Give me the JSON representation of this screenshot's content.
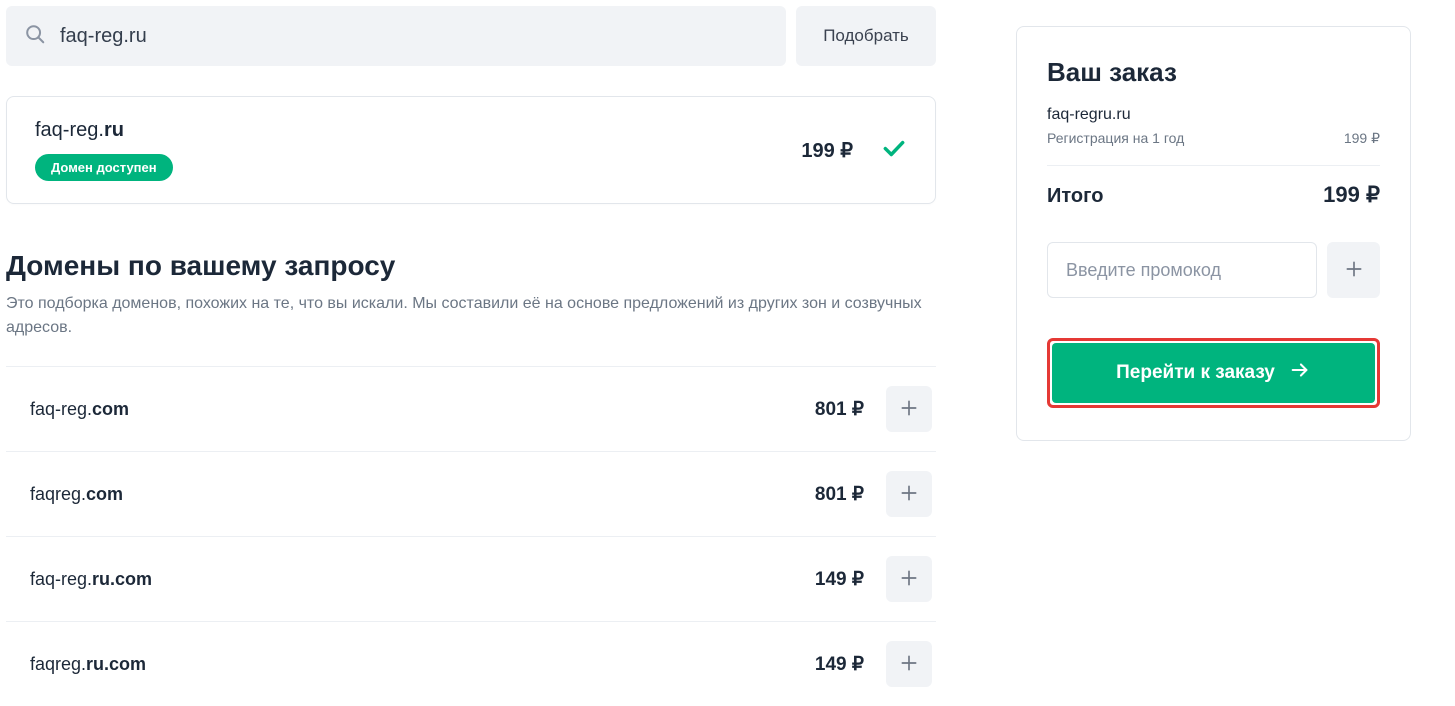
{
  "search": {
    "value": "faq-reg.ru",
    "button_label": "Подобрать"
  },
  "selected": {
    "name": "faq-reg.",
    "tld": "ru",
    "price": "199 ₽",
    "badge": "Домен доступен"
  },
  "suggestions": {
    "title": "Домены по вашему запросу",
    "description": "Это подборка доменов, похожих на те, что вы искали. Мы составили её на основе предложений из других зон и созвучных адресов.",
    "items": [
      {
        "name": "faq-reg.",
        "tld": "com",
        "price": "801 ₽"
      },
      {
        "name": "faqreg.",
        "tld": "com",
        "price": "801 ₽"
      },
      {
        "name": "faq-reg.",
        "tld": "ru.com",
        "price": "149 ₽"
      },
      {
        "name": "faqreg.",
        "tld": "ru.com",
        "price": "149 ₽"
      }
    ]
  },
  "order": {
    "title": "Ваш заказ",
    "item_name": "faq-regru.ru",
    "line_label": "Регистрация на 1 год",
    "line_price": "199 ₽",
    "total_label": "Итого",
    "total_value": "199 ₽",
    "promo_placeholder": "Введите промокод",
    "checkout_label": "Перейти к заказу"
  }
}
